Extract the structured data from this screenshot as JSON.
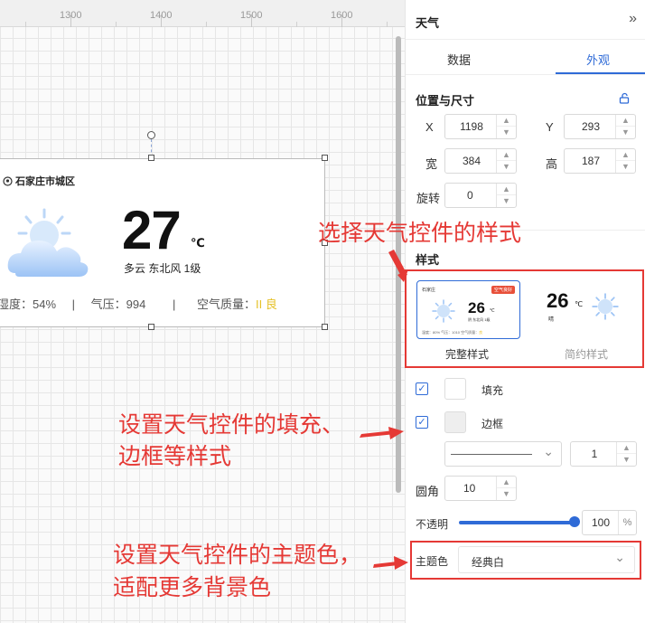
{
  "ruler": {
    "labels": [
      "1300",
      "1400",
      "1500",
      "1600"
    ]
  },
  "widget": {
    "location": "石家庄市城区",
    "temperature": "27",
    "unit": "℃",
    "desc": "多云   东北风 1级",
    "humidity": "湿度：54%",
    "pressure": "气压：994",
    "air_label": "空气质量：",
    "air_value": "II 良",
    "sep": "|"
  },
  "panel": {
    "title": "天气",
    "collapse_icon": "»",
    "tabs": [
      {
        "label": "数据"
      },
      {
        "label": "外观"
      }
    ],
    "active_tab": "外观",
    "section_position": "位置与尺寸",
    "x": {
      "label": "X",
      "value": "1198"
    },
    "y": {
      "label": "Y",
      "value": "293"
    },
    "w": {
      "label": "宽",
      "value": "384"
    },
    "h": {
      "label": "高",
      "value": "187"
    },
    "rotate": {
      "label": "旋转",
      "value": "0"
    },
    "section_style": "样式",
    "styles": [
      {
        "label": "完整样式",
        "selected": true
      },
      {
        "label": "简约样式",
        "selected": false
      }
    ],
    "fill": {
      "label": "填充",
      "checked": true
    },
    "border": {
      "label": "边框",
      "checked": true,
      "width": "1"
    },
    "radius": {
      "label": "圆角",
      "value": "10"
    },
    "opacity": {
      "label": "不透明",
      "value": "100",
      "unit": "%",
      "level": 1.0
    },
    "theme": {
      "label": "主题色",
      "value": "经典白"
    },
    "stepper_up": "▲",
    "stepper_down": "▼",
    "chevron": "⌄",
    "checkmark": "✓",
    "lock_icon": "🔓"
  },
  "preview": {
    "full": {
      "location": "石家庄",
      "badge": "空气良好",
      "temp": "26",
      "unit": "℃",
      "desc": "阴  东北风 1级",
      "stats": "湿度：80%   气压：1010   空气质量：",
      "stats_value": "良"
    },
    "simple": {
      "temp": "26",
      "unit": "℃",
      "desc": "晴"
    }
  },
  "annotations": {
    "a1": "选择天气控件的样式",
    "a2_line1": "设置天气控件的填充、",
    "a2_line2": "边框等样式",
    "a3_line1": "设置天气控件的主题色，",
    "a3_line2": "适配更多背景色"
  },
  "colors": {
    "accent": "#2f6bd7",
    "annotation": "#e53935",
    "air_quality": "#e6c229"
  }
}
